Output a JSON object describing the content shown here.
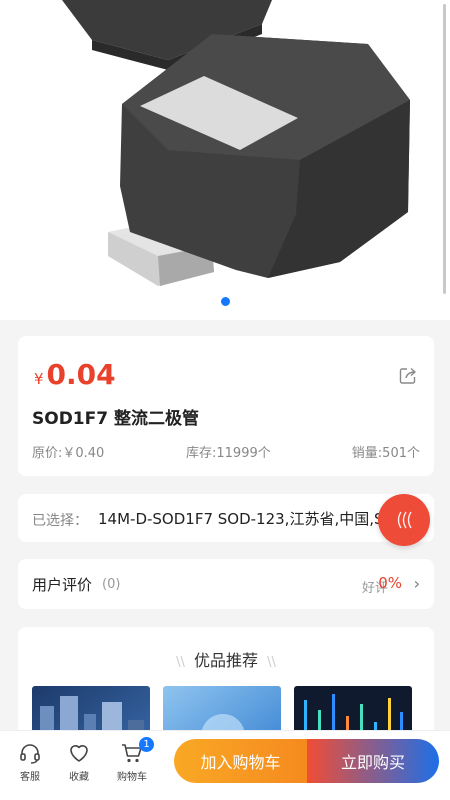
{
  "product": {
    "price_symbol": "¥",
    "price": "0.04",
    "title": "SOD1F7 整流二极管",
    "original_price": "原价:￥0.40",
    "stock": "库存:11999个",
    "sales": "销量:501个"
  },
  "carousel": {
    "active_index": 0,
    "total": 1
  },
  "selection": {
    "label": "已选择：",
    "value": "14M-D-SOD1F7 SOD-123,江苏省,中国,SC-76"
  },
  "reviews": {
    "title": "用户评价",
    "count": "(0)",
    "good_label": "好评",
    "good_percent": "0%",
    "chevron": "›"
  },
  "recommend": {
    "title": "优品推荐",
    "deco_left": "\\\\",
    "deco_right": "\\\\"
  },
  "bottom_bar": {
    "service_label": "客服",
    "favorite_label": "收藏",
    "cart_label": "购物车",
    "cart_badge": "1",
    "add_to_cart": "加入购物车",
    "buy_now": "立即购买"
  },
  "colors": {
    "price": "#e8412c",
    "accent_blue": "#1677ff",
    "cart_button": "#f9a825",
    "buy_button_start": "#f04d34",
    "buy_button_end": "#1e6fe8",
    "float_button": "#ef4b39"
  },
  "icons": {
    "share": "share-icon",
    "service": "headset-icon",
    "favorite": "heart-icon",
    "cart": "cart-icon",
    "float": "wave-icon"
  }
}
